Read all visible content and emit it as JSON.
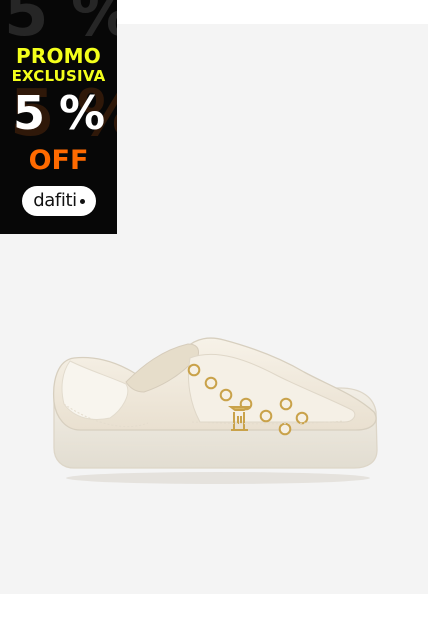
{
  "promo": {
    "line1": "PROMO",
    "line2": "EXCLUSIVA",
    "discount": "5 %",
    "off": "OFF",
    "brand": "dafiti",
    "background_text": "5 %"
  },
  "colors": {
    "badge_bg": "#070707",
    "promo_yellow": "#f3ff1b",
    "discount_white": "#ffffff",
    "off_orange": "#ff6a00",
    "photo_bg": "#f4f4f4",
    "shoe_cream": "#ede6d8",
    "eyelet_gold": "#c9a24a"
  },
  "product": {
    "image_subject": "cream low-top sneaker with gold eyelets"
  }
}
